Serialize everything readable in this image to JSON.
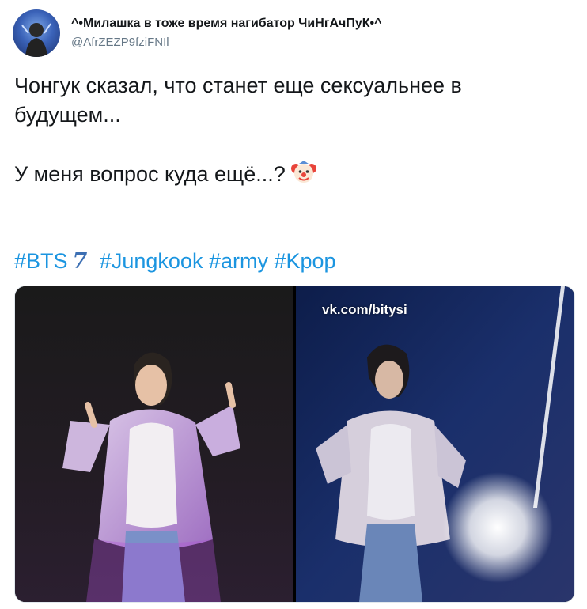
{
  "tweet": {
    "author": {
      "display_name": "^•Милашка в тоже время нагибатор ЧиНгАчПуК•^",
      "handle": "@AfrZEZP9fziFNIl"
    },
    "text_lines": [
      "Чонгук сказал, что станет еще сексуальнее в",
      "будущем...",
      "У меня вопрос куда ещё...?"
    ],
    "emoji": "clown-face",
    "hashtags": [
      "#BTS",
      "#Jungkook",
      "#army",
      "#Kpop"
    ],
    "bts_emoji_glyph": "7",
    "media": {
      "photos": [
        {
          "name": "performer-photo-left"
        },
        {
          "name": "performer-photo-right",
          "watermark": "vk.com/bitysi"
        }
      ]
    }
  },
  "colors": {
    "text": "#14171a",
    "secondary": "#657786",
    "link": "#1b95e0"
  }
}
